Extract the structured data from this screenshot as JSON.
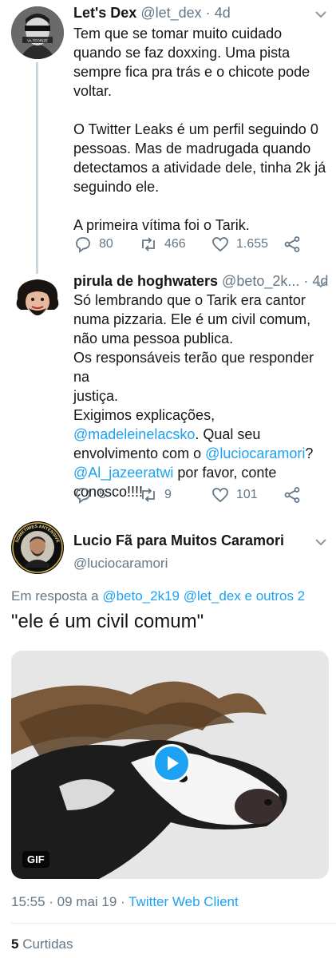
{
  "tweets": [
    {
      "name": "Let's Dex",
      "handle": "@let_dex",
      "sep": "·",
      "time": "4d",
      "lines": [
        "Tem que se tomar muito cuidado",
        "quando se faz doxxing. Uma pista",
        "sempre fica pra trás e o chicote pode",
        "voltar.",
        "",
        "O Twitter Leaks é um perfil seguindo 0",
        "pessoas. Mas de madrugada quando",
        "detectamos a atividade dele, tinha 2k já",
        "seguindo ele.",
        "",
        "A primeira vítima foi o Tarik."
      ],
      "replies": "80",
      "retweets": "466",
      "likes": "1.655",
      "avatar_caption": "VA TEORIZE"
    },
    {
      "name": "pirula de hoghwaters",
      "handle": "@beto_2k...",
      "sep": "·",
      "time": "4d",
      "lines": [
        "Só lembrando que o Tarik era cantor",
        "numa pizzaria. Ele é um civil comum,",
        "não uma pessoa publica.",
        "Os responsáveis terão que responder na",
        "justiça.",
        "Exigimos explicações,"
      ],
      "line7_link": "@madeleinelacsko",
      "line7_text": ". Qual seu",
      "line8_text": "envolvimento com o ",
      "line8_link": "@luciocaramori",
      "line8_end": "?",
      "line9_link": "@Al_jazeeratwi",
      "line9_text": " por favor, conte",
      "line10_text": "conosco!!!!",
      "replies": "5",
      "retweets": "9",
      "likes": "101"
    }
  ],
  "main_tweet": {
    "name": "Lucio Fã para Muitos Caramori",
    "handle": "@luciocaramori",
    "avatar_ring_text": "SOMETIMES ANTENSIVE",
    "reply_prefix": "Em resposta a ",
    "reply_user1": "@beto_2k19",
    "reply_user2": "@let_dex",
    "reply_rest": " e outros 2",
    "text": "\"ele é um civil comum\"",
    "gif_label": "GIF",
    "time": "15:55 · 09 mai 19 · ",
    "client": "Twitter Web Client",
    "likes_count": "5",
    "likes_label": " Curtidas"
  },
  "colors": {
    "accent": "#1da1f2",
    "text": "#14171a",
    "muted": "#657786",
    "line": "#ccd6dd"
  }
}
